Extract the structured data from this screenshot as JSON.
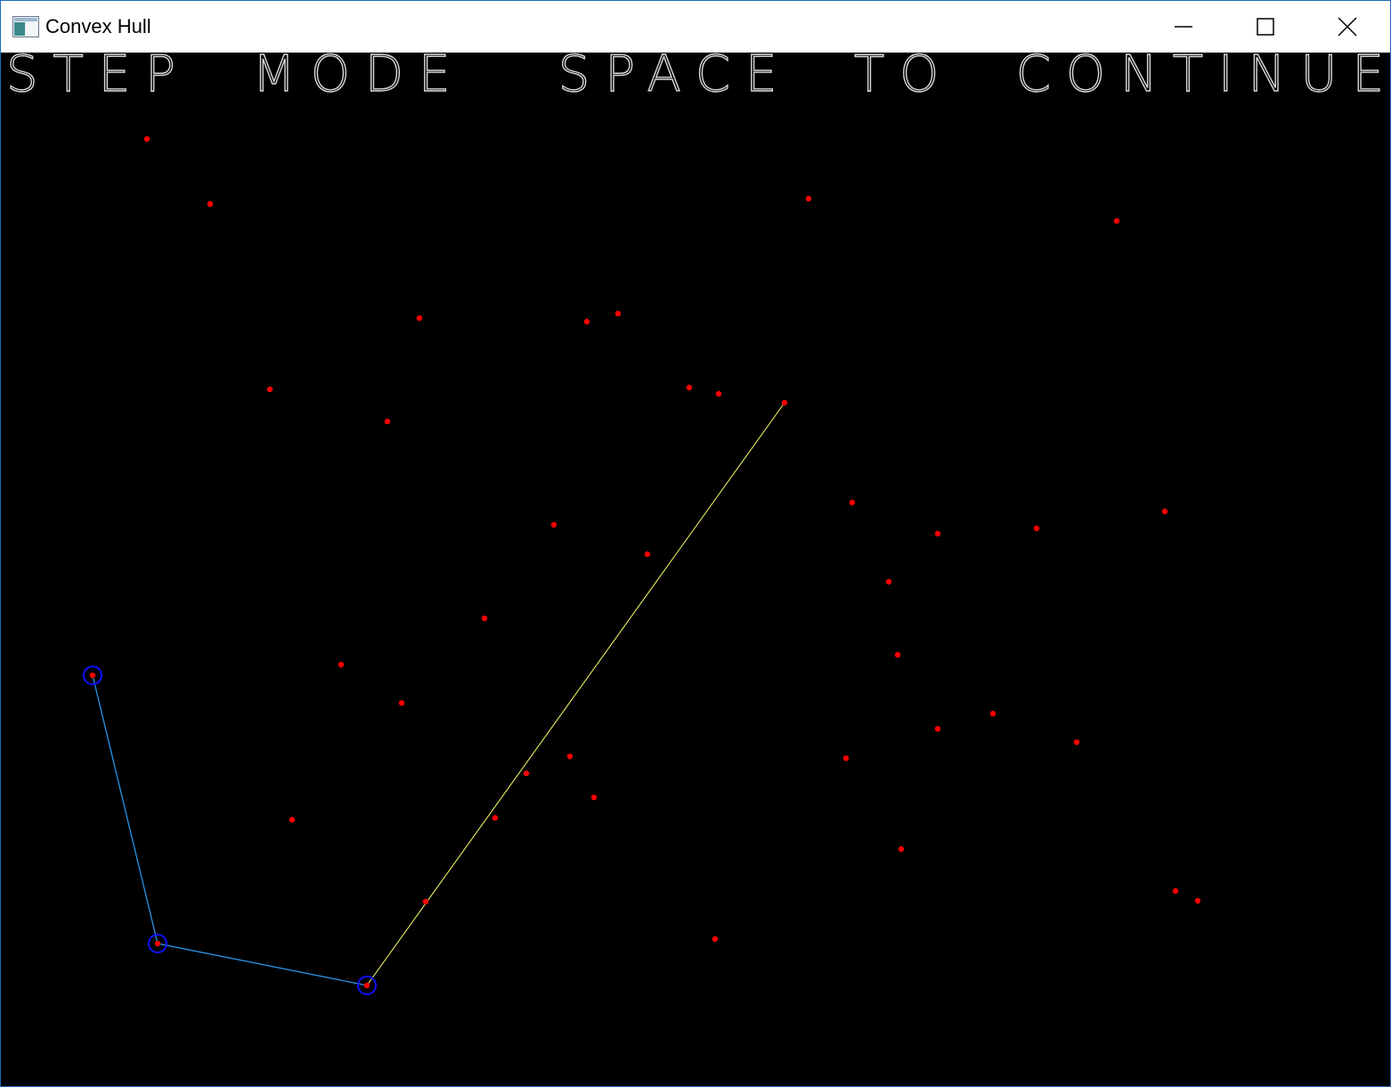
{
  "window": {
    "title": "Convex Hull",
    "icon": "app-window-icon",
    "controls": [
      "minimize-icon",
      "maximize-icon",
      "close-icon"
    ]
  },
  "banner": {
    "text": "STEP  MODE   SPACE  TO  CONTINUE"
  },
  "colors": {
    "background": "#000000",
    "point": "#ff0000",
    "hull_edge": "#1e90ff",
    "hull_vertex_ring": "#0000ff",
    "candidate_edge": "#ffff66",
    "banner_text": "#d8d8d8"
  }
}
